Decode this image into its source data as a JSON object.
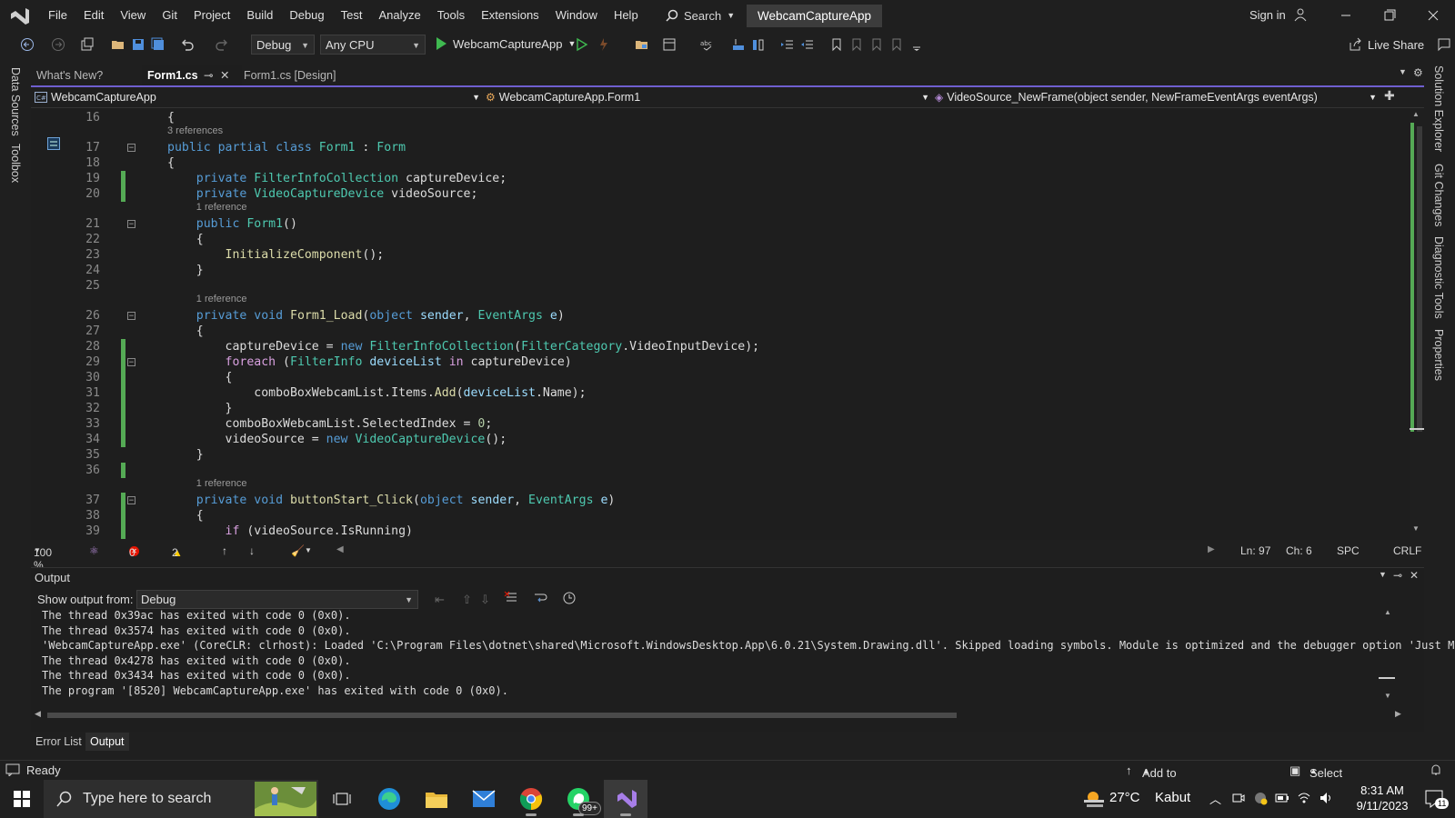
{
  "menu": {
    "items": [
      "File",
      "Edit",
      "View",
      "Git",
      "Project",
      "Build",
      "Debug",
      "Test",
      "Analyze",
      "Tools",
      "Extensions",
      "Window",
      "Help"
    ],
    "search_label": "Search",
    "solution_name": "WebcamCaptureApp",
    "sign_in": "Sign in"
  },
  "toolbar": {
    "configuration": "Debug",
    "platform": "Any CPU",
    "start_target": "WebcamCaptureApp",
    "live_share": "Live Share"
  },
  "side_panels": {
    "left": [
      "Data Sources",
      "Toolbox"
    ],
    "right": [
      "Solution Explorer",
      "Git Changes",
      "Diagnostic Tools",
      "Properties"
    ]
  },
  "doc_tabs": [
    {
      "label": "What's New?",
      "active": false
    },
    {
      "label": "Form1.cs",
      "active": true
    },
    {
      "label": "Form1.cs [Design]",
      "active": false
    }
  ],
  "navbar": {
    "project": "WebcamCaptureApp",
    "class": "WebcamCaptureApp.Form1",
    "member": "VideoSource_NewFrame(object sender, NewFrameEventArgs eventArgs)"
  },
  "editor": {
    "lines": [
      {
        "n": "16",
        "tokens": [
          [
            "p",
            "{"
          ]
        ]
      },
      {
        "n": "17",
        "lens": "3 references",
        "tokens": [
          [
            "kw",
            "public "
          ],
          [
            "kw",
            "partial "
          ],
          [
            "kw",
            "class "
          ],
          [
            "ty",
            "Form1"
          ],
          [
            "p",
            " : "
          ],
          [
            "ty",
            "Form"
          ]
        ]
      },
      {
        "n": "18",
        "tokens": [
          [
            "p",
            "{"
          ]
        ]
      },
      {
        "n": "19",
        "tokens": [
          [
            "p",
            "    "
          ],
          [
            "kw",
            "private "
          ],
          [
            "ty",
            "FilterInfoCollection"
          ],
          [
            "p",
            " captureDevice;"
          ]
        ]
      },
      {
        "n": "20",
        "tokens": [
          [
            "p",
            "    "
          ],
          [
            "kw",
            "private "
          ],
          [
            "ty",
            "VideoCaptureDevice"
          ],
          [
            "p",
            " videoSource;"
          ]
        ]
      },
      {
        "n": "21",
        "lens": "1 reference",
        "tokens": [
          [
            "p",
            "    "
          ],
          [
            "kw",
            "public "
          ],
          [
            "ty",
            "Form1"
          ],
          [
            "p",
            "()"
          ]
        ]
      },
      {
        "n": "22",
        "tokens": [
          [
            "p",
            "    {"
          ]
        ]
      },
      {
        "n": "23",
        "tokens": [
          [
            "p",
            "        "
          ],
          [
            "fn",
            "InitializeComponent"
          ],
          [
            "p",
            "();"
          ]
        ]
      },
      {
        "n": "24",
        "tokens": [
          [
            "p",
            "    }"
          ]
        ]
      },
      {
        "n": "25",
        "tokens": [
          [
            "p",
            ""
          ]
        ]
      },
      {
        "n": "26",
        "lens": "1 reference",
        "tokens": [
          [
            "p",
            "    "
          ],
          [
            "kw",
            "private "
          ],
          [
            "kw",
            "void "
          ],
          [
            "fn",
            "Form1_Load"
          ],
          [
            "p",
            "("
          ],
          [
            "kw",
            "object "
          ],
          [
            "pm",
            "sender"
          ],
          [
            "p",
            ", "
          ],
          [
            "ty",
            "EventArgs"
          ],
          [
            "p",
            " "
          ],
          [
            "pm",
            "e"
          ],
          [
            "p",
            ")"
          ]
        ]
      },
      {
        "n": "27",
        "tokens": [
          [
            "p",
            "    {"
          ]
        ]
      },
      {
        "n": "28",
        "tokens": [
          [
            "p",
            "        captureDevice = "
          ],
          [
            "kw",
            "new "
          ],
          [
            "ty",
            "FilterInfoCollection"
          ],
          [
            "p",
            "("
          ],
          [
            "ty",
            "FilterCategory"
          ],
          [
            "p",
            ".VideoInputDevice);"
          ]
        ]
      },
      {
        "n": "29",
        "tokens": [
          [
            "p",
            "        "
          ],
          [
            "kc",
            "foreach"
          ],
          [
            "p",
            " ("
          ],
          [
            "ty",
            "FilterInfo"
          ],
          [
            "p",
            " "
          ],
          [
            "pm",
            "deviceList"
          ],
          [
            "p",
            " "
          ],
          [
            "kc",
            "in"
          ],
          [
            "p",
            " captureDevice)"
          ]
        ]
      },
      {
        "n": "30",
        "tokens": [
          [
            "p",
            "        {"
          ]
        ]
      },
      {
        "n": "31",
        "tokens": [
          [
            "p",
            "            comboBoxWebcamList.Items."
          ],
          [
            "fn",
            "Add"
          ],
          [
            "p",
            "("
          ],
          [
            "pm",
            "deviceList"
          ],
          [
            "p",
            ".Name);"
          ]
        ]
      },
      {
        "n": "32",
        "tokens": [
          [
            "p",
            "        }"
          ]
        ]
      },
      {
        "n": "33",
        "tokens": [
          [
            "p",
            "        comboBoxWebcamList.SelectedIndex = "
          ],
          [
            "nu",
            "0"
          ],
          [
            "p",
            ";"
          ]
        ]
      },
      {
        "n": "34",
        "tokens": [
          [
            "p",
            "        videoSource = "
          ],
          [
            "kw",
            "new "
          ],
          [
            "ty",
            "VideoCaptureDevice"
          ],
          [
            "p",
            "();"
          ]
        ]
      },
      {
        "n": "35",
        "tokens": [
          [
            "p",
            "    }"
          ]
        ]
      },
      {
        "n": "36",
        "tokens": [
          [
            "p",
            ""
          ]
        ]
      },
      {
        "n": "37",
        "lens": "1 reference",
        "tokens": [
          [
            "p",
            "    "
          ],
          [
            "kw",
            "private "
          ],
          [
            "kw",
            "void "
          ],
          [
            "fn",
            "buttonStart_Click"
          ],
          [
            "p",
            "("
          ],
          [
            "kw",
            "object "
          ],
          [
            "pm",
            "sender"
          ],
          [
            "p",
            ", "
          ],
          [
            "ty",
            "EventArgs"
          ],
          [
            "p",
            " "
          ],
          [
            "pm",
            "e"
          ],
          [
            "p",
            ")"
          ]
        ]
      },
      {
        "n": "38",
        "tokens": [
          [
            "p",
            "    {"
          ]
        ]
      },
      {
        "n": "39",
        "tokens": [
          [
            "p",
            "        "
          ],
          [
            "kc",
            "if"
          ],
          [
            "p",
            " (videoSource.IsRunning)"
          ]
        ]
      }
    ]
  },
  "editor_status": {
    "zoom": "100 %",
    "errors": "0",
    "warnings": "2",
    "line": "Ln: 97",
    "col": "Ch: 6",
    "whitespace": "SPC",
    "line_endings": "CRLF"
  },
  "output": {
    "title": "Output",
    "show_from_label": "Show output from:",
    "show_from_value": "Debug",
    "lines": [
      "The thread 0x39ac has exited with code 0 (0x0).",
      "The thread 0x3574 has exited with code 0 (0x0).",
      "'WebcamCaptureApp.exe' (CoreCLR: clrhost): Loaded 'C:\\Program Files\\dotnet\\shared\\Microsoft.WindowsDesktop.App\\6.0.21\\System.Drawing.dll'. Skipped loading symbols. Module is optimized and the debugger option 'Just My Code' is",
      "The thread 0x4278 has exited with code 0 (0x0).",
      "The thread 0x3434 has exited with code 0 (0x0).",
      "The program '[8520] WebcamCaptureApp.exe' has exited with code 0 (0x0)."
    ]
  },
  "bottom_tabs": [
    {
      "label": "Error List",
      "active": false
    },
    {
      "label": "Output",
      "active": true
    }
  ],
  "statusbar": {
    "ready": "Ready",
    "source_control": "Add to Source Control",
    "repository": "Select Repository"
  },
  "taskbar": {
    "search_placeholder": "Type here to search",
    "whatsapp_badge": "99+",
    "weather_temp": "27°C",
    "weather_desc": "Kabut",
    "time": "8:31 AM",
    "date": "9/11/2023",
    "notification_count": "11"
  },
  "colors": {
    "accent": "#6f5fcf",
    "run_green": "#3fb950",
    "error_red": "#e51400",
    "warning_yellow": "#ffcc00"
  }
}
